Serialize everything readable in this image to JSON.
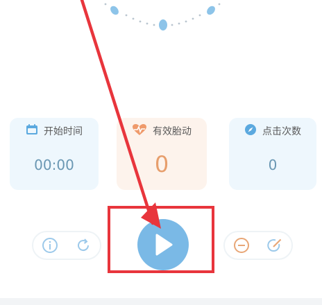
{
  "colors": {
    "accent_blue": "#7ab9e6",
    "accent_orange": "#e79e6c",
    "highlight_red": "#e8353c",
    "card_blue_bg": "#eef7fd",
    "card_orange_bg": "#fdf3ec"
  },
  "stats": {
    "start_time": {
      "label": "开始时间",
      "value": "00:00",
      "icon": "calendar-icon"
    },
    "effective_movements": {
      "label": "有效胎动",
      "value": "0",
      "icon": "heartbeat-icon"
    },
    "click_count": {
      "label": "点击次数",
      "value": "0",
      "icon": "compass-icon"
    }
  },
  "controls": {
    "left": [
      "info-icon",
      "refresh-icon"
    ],
    "center": "play-icon",
    "right": [
      "minus-icon",
      "edit-icon"
    ]
  }
}
